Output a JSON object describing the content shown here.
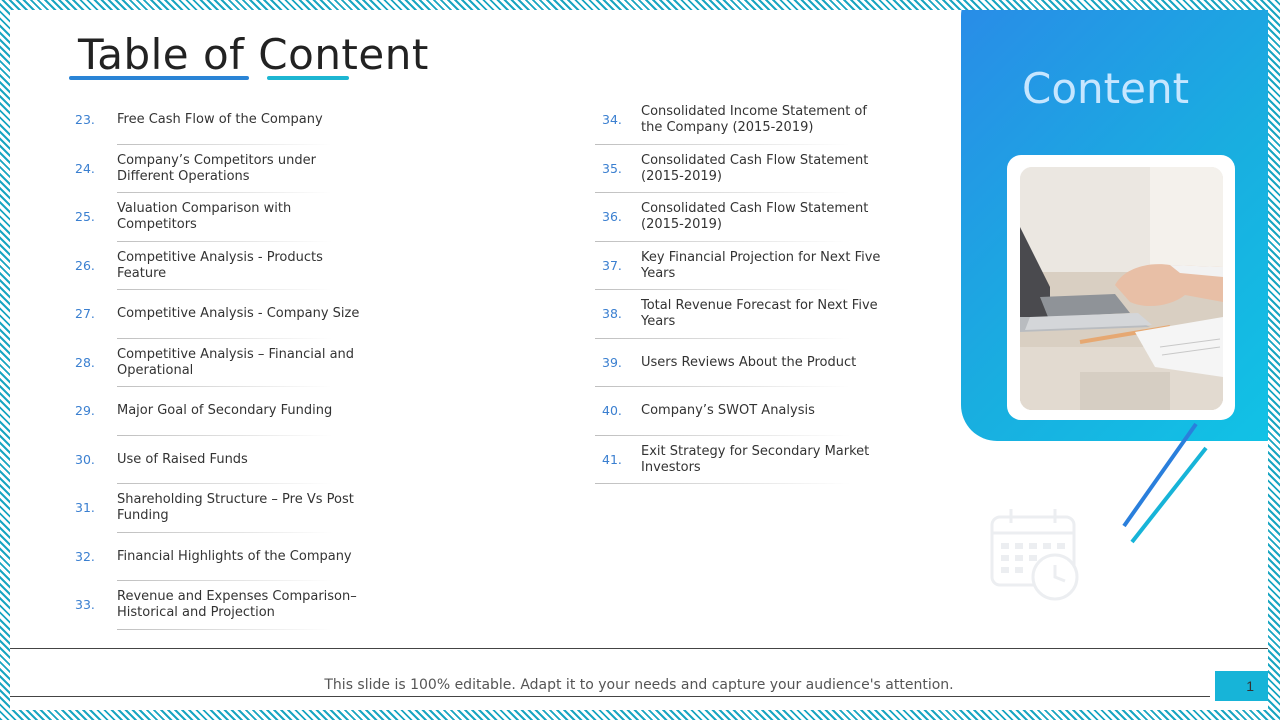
{
  "title": "Table of Content",
  "panel": {
    "title": "Content",
    "photo_icon": "laptop-photo",
    "decor_icon": "calendar-clock-icon"
  },
  "toc_left": [
    {
      "num": "23.",
      "text": "Free Cash Flow of the Company"
    },
    {
      "num": "24.",
      "text": "Company’s Competitors under Different Operations"
    },
    {
      "num": "25.",
      "text": "Valuation Comparison with Competitors"
    },
    {
      "num": "26.",
      "text": "Competitive Analysis - Products Feature"
    },
    {
      "num": "27.",
      "text": "Competitive Analysis - Company Size"
    },
    {
      "num": "28.",
      "text": "Competitive Analysis – Financial and Operational"
    },
    {
      "num": "29.",
      "text": "Major Goal of Secondary Funding"
    },
    {
      "num": "30.",
      "text": "Use of Raised Funds"
    },
    {
      "num": "31.",
      "text": "Shareholding Structure – Pre Vs Post Funding"
    },
    {
      "num": "32.",
      "text": "Financial Highlights of the Company"
    },
    {
      "num": "33.",
      "text": "Revenue and Expenses Comparison– Historical and Projection"
    }
  ],
  "toc_right": [
    {
      "num": "34.",
      "text": "Consolidated Income Statement of the Company (2015-2019)"
    },
    {
      "num": "35.",
      "text": "Consolidated Cash Flow Statement (2015-2019)"
    },
    {
      "num": "36.",
      "text": "Consolidated Cash Flow Statement (2015-2019)"
    },
    {
      "num": "37.",
      "text": "Key Financial Projection for Next Five Years"
    },
    {
      "num": "38.",
      "text": "Total Revenue Forecast for Next Five Years"
    },
    {
      "num": "39.",
      "text": "Users Reviews About the Product"
    },
    {
      "num": "40.",
      "text": "Company’s SWOT Analysis"
    },
    {
      "num": "41.",
      "text": "Exit Strategy for Secondary Market Investors"
    }
  ],
  "footer": {
    "text": "This slide is 100% editable. Adapt it to your needs and capture your audience's attention.",
    "page_number": "1"
  },
  "colors": {
    "accent_blue": "#2a84d6",
    "accent_cyan": "#1db6d2",
    "number_blue": "#3a7fd0"
  }
}
